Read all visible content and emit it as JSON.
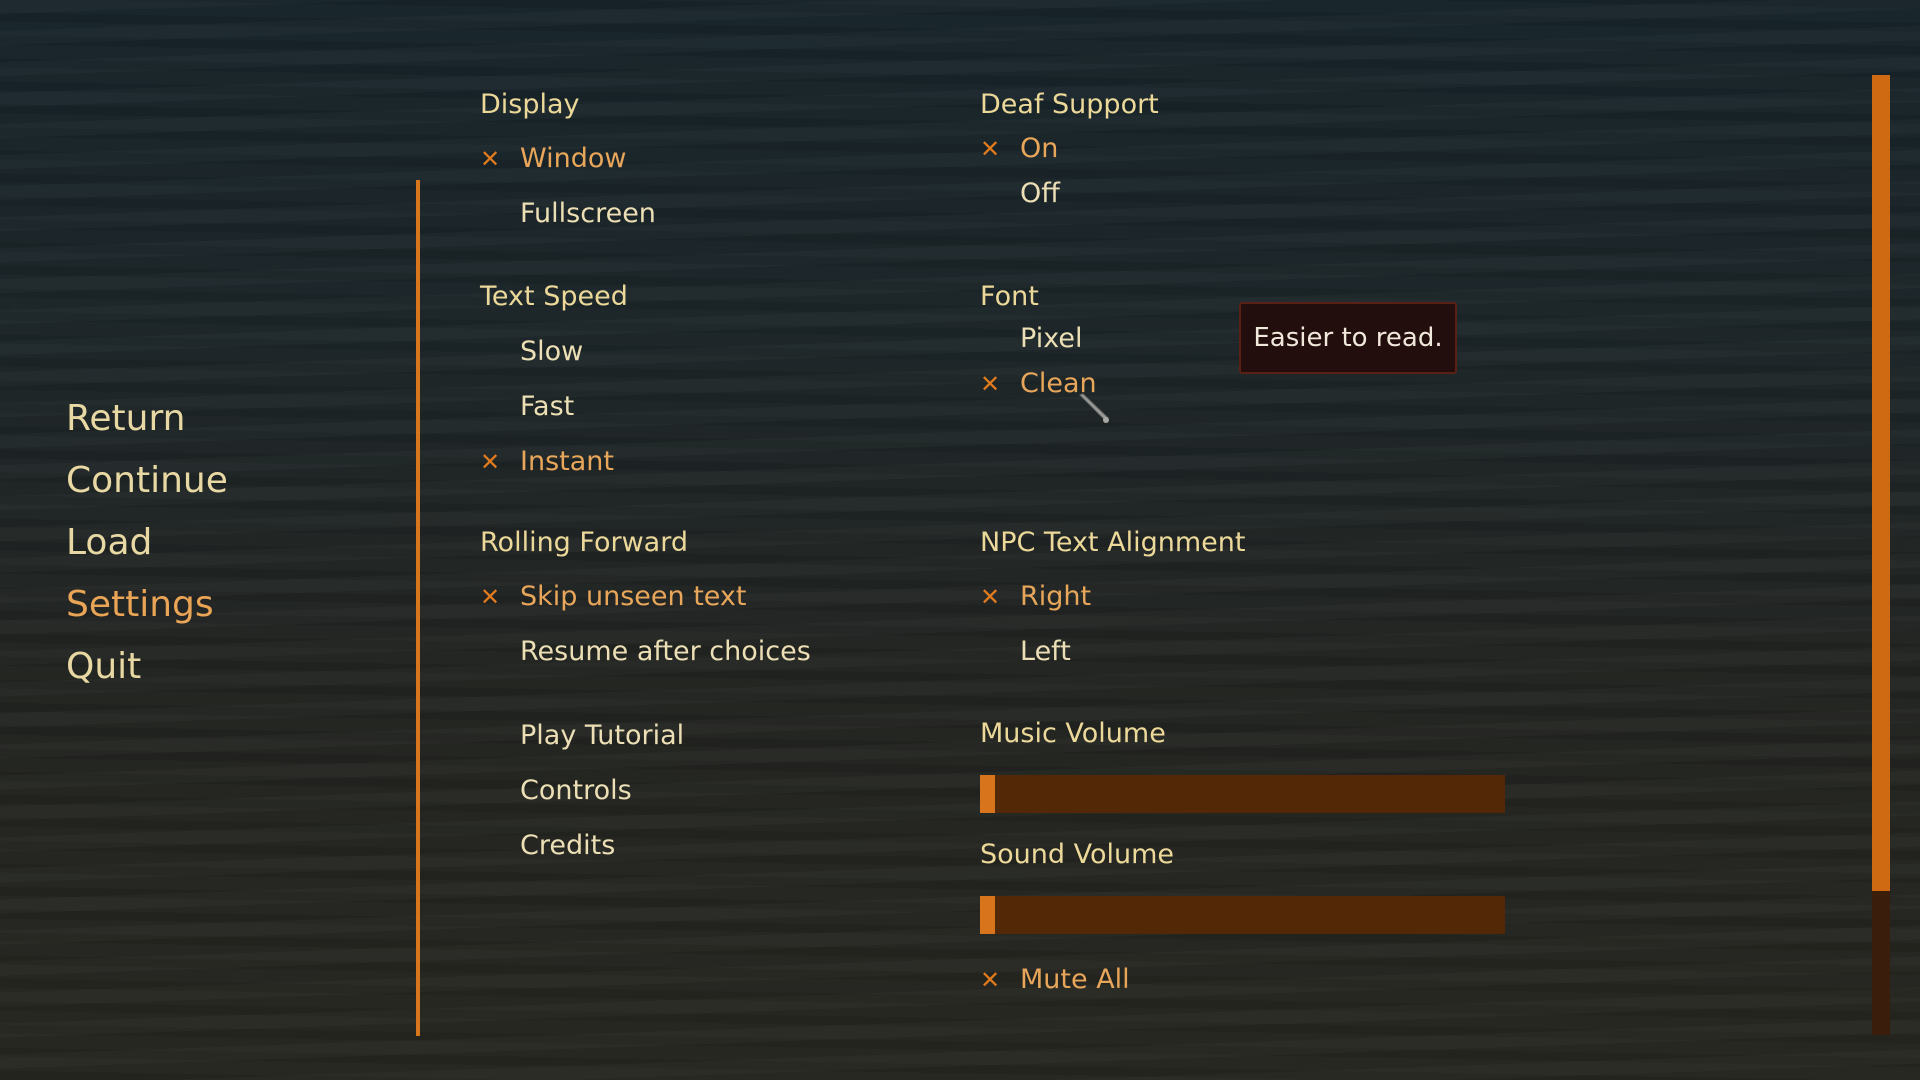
{
  "nav": {
    "items": [
      {
        "label": "Return",
        "active": false
      },
      {
        "label": "Continue",
        "active": false
      },
      {
        "label": "Load",
        "active": false
      },
      {
        "label": "Settings",
        "active": true
      },
      {
        "label": "Quit",
        "active": false
      }
    ]
  },
  "settings": {
    "display": {
      "title": "Display",
      "options": [
        {
          "label": "Window",
          "selected": true
        },
        {
          "label": "Fullscreen",
          "selected": false
        }
      ]
    },
    "text_speed": {
      "title": "Text Speed",
      "options": [
        {
          "label": "Slow",
          "selected": false
        },
        {
          "label": "Fast",
          "selected": false
        },
        {
          "label": "Instant",
          "selected": true
        }
      ]
    },
    "rolling_forward": {
      "title": "Rolling Forward",
      "options": [
        {
          "label": "Skip unseen text",
          "selected": true
        },
        {
          "label": "Resume after choices",
          "selected": false
        }
      ]
    },
    "extras": {
      "options": [
        {
          "label": "Play Tutorial"
        },
        {
          "label": "Controls"
        },
        {
          "label": "Credits"
        }
      ]
    },
    "deaf_support": {
      "title": "Deaf Support",
      "options": [
        {
          "label": "On",
          "selected": true
        },
        {
          "label": "Off",
          "selected": false
        }
      ]
    },
    "font": {
      "title": "Font",
      "options": [
        {
          "label": "Pixel",
          "selected": false
        },
        {
          "label": "Clean",
          "selected": true
        }
      ]
    },
    "npc_text_alignment": {
      "title": "NPC Text Alignment",
      "options": [
        {
          "label": "Right",
          "selected": true
        },
        {
          "label": "Left",
          "selected": false
        }
      ]
    },
    "music_volume": {
      "title": "Music Volume",
      "value": 0
    },
    "sound_volume": {
      "title": "Sound Volume",
      "value": 0
    },
    "mute_all": {
      "label": "Mute All",
      "selected": true
    }
  },
  "tooltip": {
    "text": "Easier to read."
  },
  "scrollbar": {
    "position": 0,
    "visible_fraction": 0.85
  },
  "icons": {
    "selected_mark": "x-mark-icon",
    "cursor": "arrow-cursor-icon"
  },
  "colors": {
    "accent": "#d8761e",
    "text": "#ecdfb5",
    "selected_text": "#e8a65a",
    "slider_track": "#522806",
    "tooltip_bg": "#220e0c"
  }
}
